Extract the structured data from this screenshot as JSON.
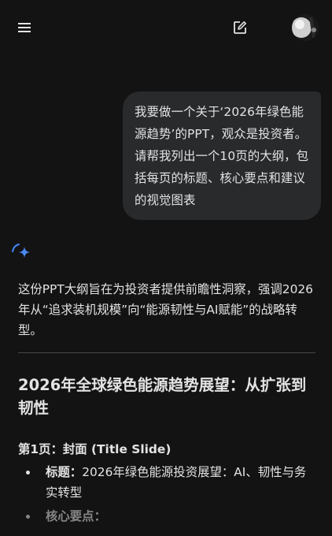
{
  "topbar": {
    "menu_icon": "hamburger-menu-icon",
    "new_chat_icon": "edit-pencil-icon",
    "avatar_icon": "user-avatar"
  },
  "user_message": {
    "text": "我要做一个关于‘2026年绿色能源趋势’的PPT，观众是投资者。请帮我列出一个10页的大纲，包括每页的标题、核心要点和建议的视觉图表"
  },
  "response": {
    "icon": "gemini-spark-icon",
    "intro": "这份PPT大纲旨在为投资者提供前瞻性洞察，强调2026年从“追求装机规模”向“能源韧性与AI赋能”的战略转型。",
    "title": "2026年全球绿色能源趋势展望：从扩张到韧性",
    "section1": {
      "heading": "第1页：封面 (Title Slide)",
      "items": [
        {
          "label": "标题：",
          "text": "2026年绿色能源投资展望：AI、韧性与务实转型"
        },
        {
          "label": "核心要点：",
          "text": ""
        }
      ]
    }
  },
  "colors": {
    "background": "#131314",
    "bubble": "#282a2c",
    "text": "#e3e3e3",
    "accent": "#4285f4"
  }
}
